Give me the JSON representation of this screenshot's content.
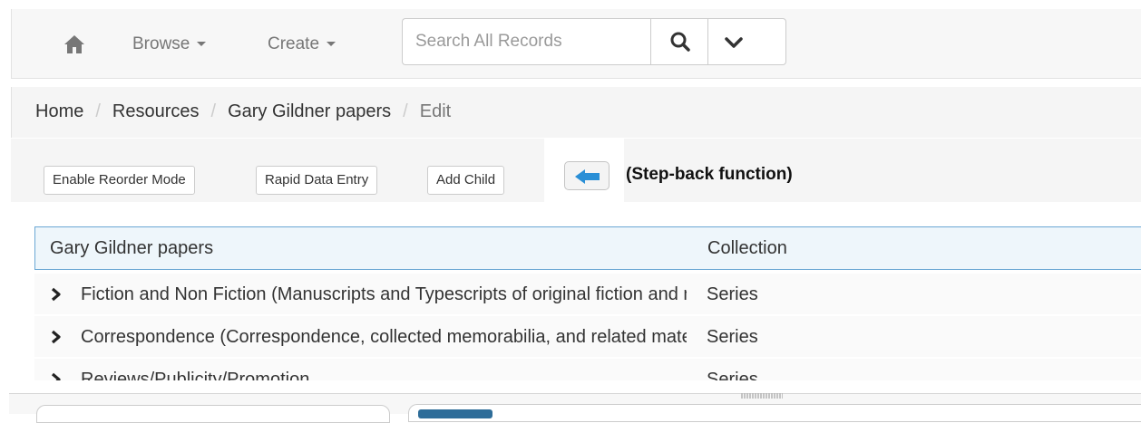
{
  "navbar": {
    "home_icon": "home-icon",
    "browse_label": "Browse",
    "create_label": "Create",
    "search_placeholder": "Search All Records",
    "search_icon": "search-icon",
    "dropdown_icon": "chevron-down-icon"
  },
  "breadcrumb": {
    "items": [
      "Home",
      "Resources",
      "Gary Gildner papers"
    ],
    "active": "Edit",
    "separator": "/"
  },
  "toolbar": {
    "reorder_label": "Enable Reorder Mode",
    "rapid_entry_label": "Rapid Data Entry",
    "add_child_label": "Add Child",
    "back_icon": "arrow-left-icon",
    "annotation": "(Step-back function)"
  },
  "tree": {
    "root": {
      "title": "Gary Gildner papers",
      "level": "Collection"
    },
    "children": [
      {
        "title": "Fiction and Non Fiction (Manuscripts and Typescripts of original fiction and non fiction)",
        "level": "Series"
      },
      {
        "title": "Correspondence (Correspondence, collected memorabilia, and related materials)",
        "level": "Series"
      },
      {
        "title": "Reviews/Publicity/Promotion",
        "level": "Series"
      }
    ]
  },
  "colors": {
    "accent": "#2e6d99",
    "selected_row_bg": "#eef6fb",
    "selected_row_border": "#6aa7d4"
  }
}
